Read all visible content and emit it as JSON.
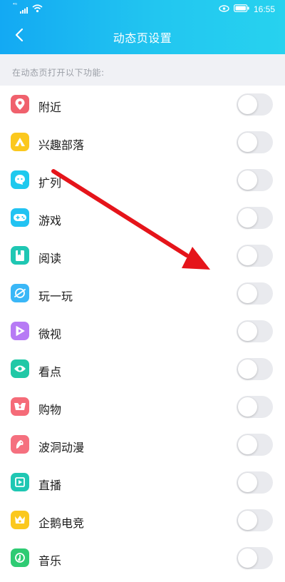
{
  "status_bar": {
    "signal_text": "⁴ᴳ",
    "time": "16:55",
    "icons": [
      "signal-icon",
      "wifi-icon",
      "eye-icon",
      "battery-icon"
    ]
  },
  "nav": {
    "back_icon": "chevron-left-icon",
    "title": "动态页设置"
  },
  "section": {
    "header": "在动态页打开以下功能:"
  },
  "items": [
    {
      "label": "附近",
      "icon": "location-pin-icon",
      "color": "#f0616d",
      "enabled": false
    },
    {
      "label": "兴趣部落",
      "icon": "tent-icon",
      "color": "#fbc81e",
      "enabled": false
    },
    {
      "label": "扩列",
      "icon": "chat-face-icon",
      "color": "#1fc9ee",
      "enabled": false
    },
    {
      "label": "游戏",
      "icon": "gamepad-icon",
      "color": "#22c3f2",
      "enabled": false
    },
    {
      "label": "阅读",
      "icon": "book-icon",
      "color": "#1fc7b3",
      "enabled": false
    },
    {
      "label": "玩一玩",
      "icon": "planet-icon",
      "color": "#3ab7f7",
      "enabled": false
    },
    {
      "label": "微视",
      "icon": "play-icon",
      "color": "#b77af5",
      "enabled": false
    },
    {
      "label": "看点",
      "icon": "eye-icon",
      "color": "#20c8a6",
      "enabled": false
    },
    {
      "label": "购物",
      "icon": "shopping-bag-icon",
      "color": "#f56b78",
      "enabled": false
    },
    {
      "label": "波洞动漫",
      "icon": "comic-icon",
      "color": "#f5707f",
      "enabled": false
    },
    {
      "label": "直播",
      "icon": "live-icon",
      "color": "#1fc7b3",
      "enabled": false
    },
    {
      "label": "企鹅电竞",
      "icon": "esports-crown-icon",
      "color": "#fbc81e",
      "enabled": false
    },
    {
      "label": "音乐",
      "icon": "music-icon",
      "color": "#2ecb73",
      "enabled": false
    }
  ],
  "annotation": {
    "arrow_color": "#e5141a"
  }
}
